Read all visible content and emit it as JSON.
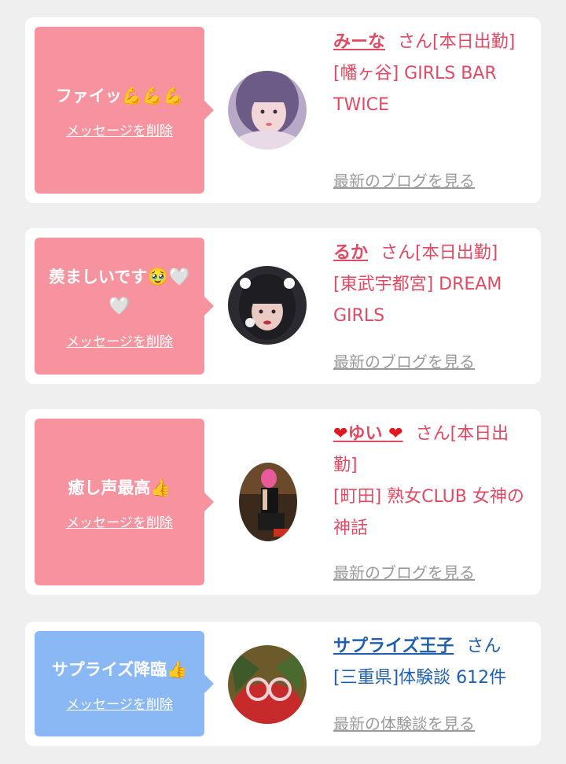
{
  "entries": [
    {
      "message": "ファイッ",
      "message_emoji": "💪💪💪",
      "delete_label": "メッセージを削除",
      "name": "みーな",
      "honorific": "さん",
      "status": "[本日出勤]",
      "shop": "[幡ヶ谷] GIRLS BAR TWICE",
      "more_label": "最新のブログを見る",
      "bubble_color": "#f6939f"
    },
    {
      "message": "羨ましいです",
      "message_emoji": "🥹🤍🤍",
      "delete_label": "メッセージを削除",
      "name": "るか",
      "honorific": "さん",
      "status": "[本日出勤]",
      "shop": "[東武宇都宮] DREAM GIRLS",
      "more_label": "最新のブログを見る",
      "bubble_color": "#f6939f"
    },
    {
      "message": "癒し声最高",
      "message_emoji": "👍",
      "delete_label": "メッセージを削除",
      "name": "ゆい",
      "name_emoji": "❤",
      "honorific": "さん",
      "status": "[本日出勤]",
      "shop": "[町田] 熟女CLUB 女神の神話",
      "more_label": "最新のブログを見る",
      "bubble_color": "#f6939f"
    },
    {
      "message": "サプライズ降臨",
      "message_emoji": "👍",
      "delete_label": "メッセージを削除",
      "name": "サプライズ王子",
      "honorific": "さん",
      "shop": "[三重県]体験談 612件",
      "more_label": "最新の体験談を見る",
      "bubble_color": "#8ab8f4"
    }
  ],
  "colors": {
    "background": "#efefef",
    "card": "#ffffff",
    "accent_pink": "#e04a63",
    "accent_blue": "#1f5fae",
    "muted_link": "#9a9a9a"
  }
}
